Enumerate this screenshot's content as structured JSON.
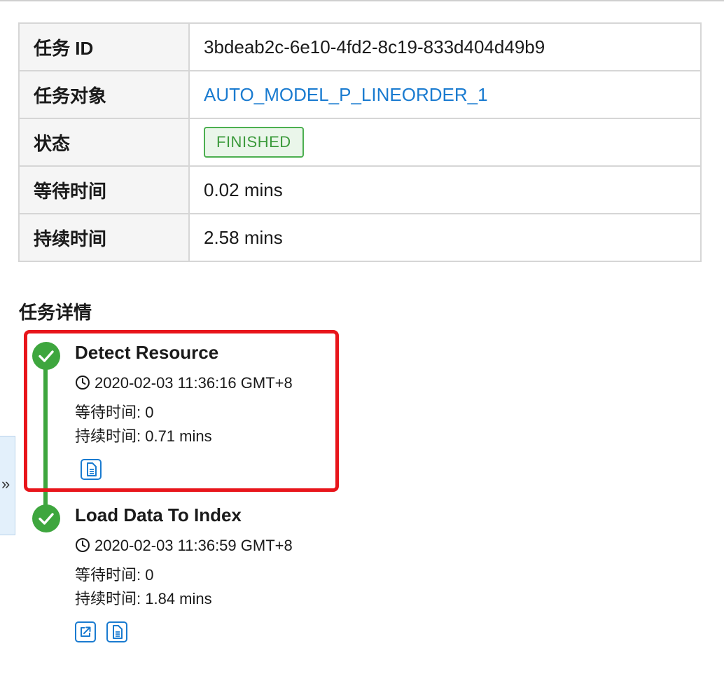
{
  "task_info": {
    "rows": [
      {
        "key": "任务 ID",
        "value": "3bdeab2c-6e10-4fd2-8c19-833d404d49b9"
      },
      {
        "key": "任务对象",
        "value": "AUTO_MODEL_P_LINEORDER_1"
      },
      {
        "key": "状态",
        "value": "FINISHED"
      },
      {
        "key": "等待时间",
        "value": "0.02 mins"
      },
      {
        "key": "持续时间",
        "value": "2.58 mins"
      }
    ]
  },
  "details": {
    "title": "任务详情",
    "steps": [
      {
        "name": "Detect Resource",
        "time": "2020-02-03 11:36:16 GMT+8",
        "wait": "等待时间: 0",
        "duration": "持续时间: 0.71 mins",
        "status": "finished"
      },
      {
        "name": "Load Data To Index",
        "time": "2020-02-03 11:36:59 GMT+8",
        "wait": "等待时间: 0",
        "duration": "持续时间: 1.84 mins",
        "status": "finished"
      }
    ]
  },
  "side_tab": {
    "glyph": "»"
  },
  "colors": {
    "accent": "#1a7bd0",
    "success": "#3ea63e",
    "highlight": "#e8151b"
  },
  "icons": [
    "check-icon",
    "clock-icon",
    "log-file-icon",
    "open-external-icon",
    "double-chevron-right-icon"
  ]
}
